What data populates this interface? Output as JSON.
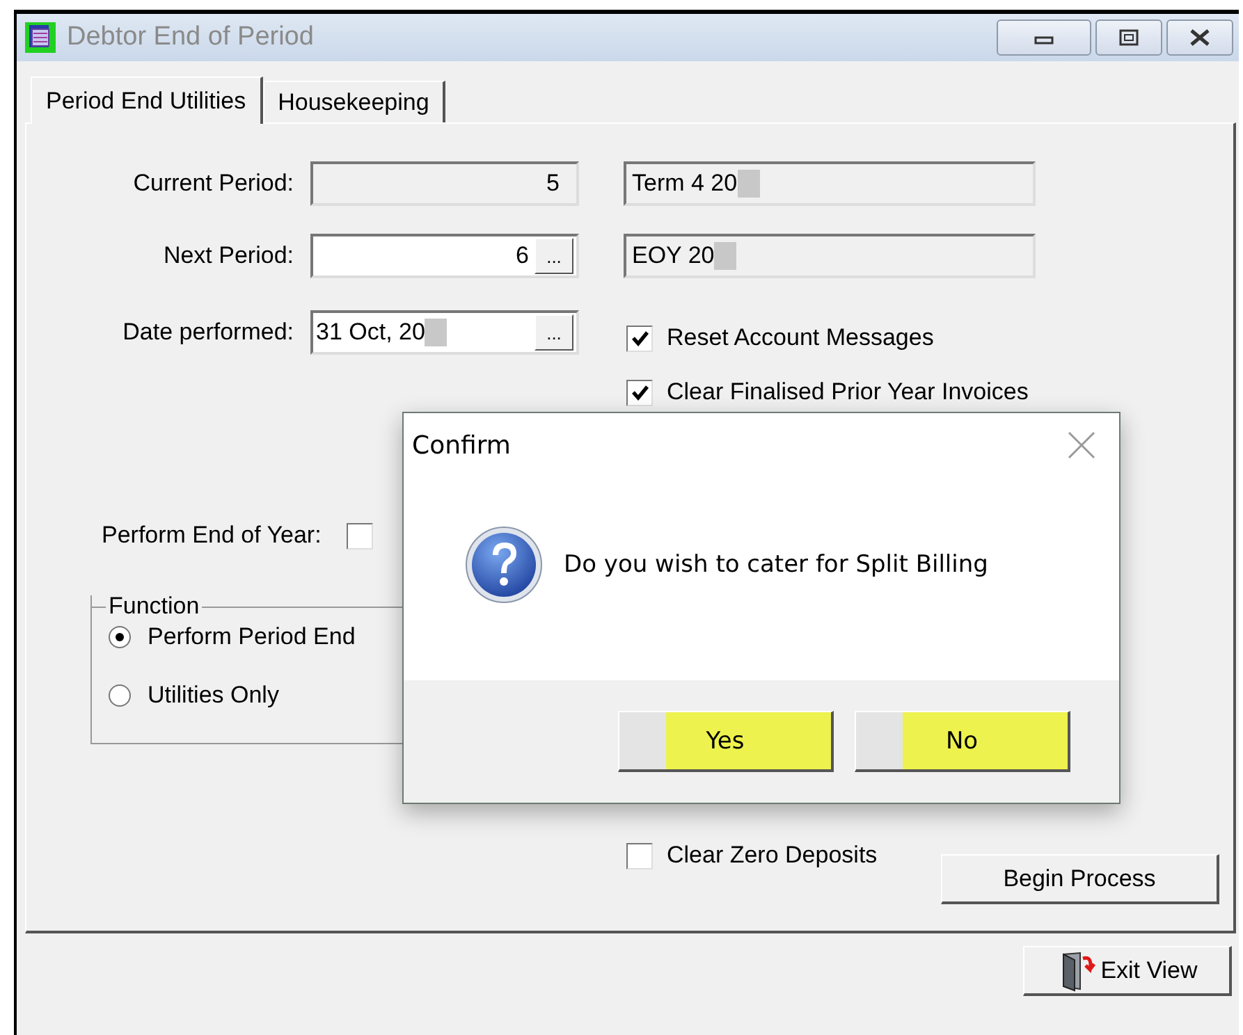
{
  "window": {
    "title": "Debtor End of Period"
  },
  "tabs": [
    {
      "label": "Period End Utilities",
      "selected": true
    },
    {
      "label": "Housekeeping",
      "selected": false
    }
  ],
  "periods": [
    {
      "label": "Current Period:",
      "value": "5",
      "readonly": true,
      "description": "Term 4 20",
      "redacted": true
    },
    {
      "label": "Next Period:",
      "value": "6",
      "readonly": false,
      "lookup_button": "...",
      "description": "EOY 20",
      "redacted": true
    }
  ],
  "date_field": {
    "label": "Date performed:",
    "value": "31 Oct, 20",
    "redacted": true,
    "picker_button": "..."
  },
  "options": [
    {
      "label": "Reset Account Messages",
      "checked": true
    },
    {
      "label": "Clear Finalised Prior Year Invoices",
      "checked": true
    }
  ],
  "end_of_year": {
    "label": "Perform End of Year:",
    "checked": false
  },
  "function_group": {
    "title": "Function",
    "options": [
      {
        "label": "Perform Period End",
        "selected": true
      },
      {
        "label": "Utilities Only",
        "selected": false
      }
    ]
  },
  "clear_zero_deposits": {
    "label": "Clear Zero Deposits",
    "checked": false
  },
  "begin_button": "Begin Process",
  "exit_button": "Exit View",
  "dialog": {
    "title": "Confirm",
    "message": "Do you wish to cater for Split Billing",
    "buttons": [
      {
        "label": "Yes",
        "highlighted": true
      },
      {
        "label": "No",
        "highlighted": true
      }
    ]
  }
}
